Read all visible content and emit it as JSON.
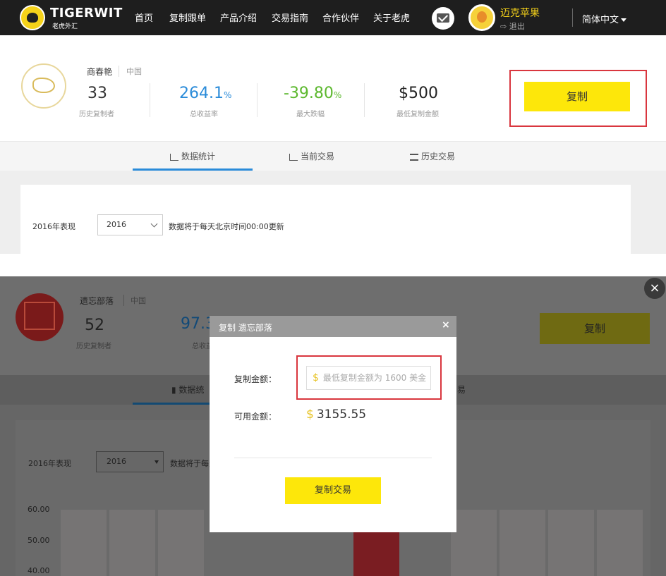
{
  "top": {
    "logo": {
      "brand": "TIGERWIT",
      "sub": "老虎外汇"
    },
    "nav": [
      "首页",
      "复制跟单",
      "产品介绍",
      "交易指南",
      "合作伙伴",
      "关于老虎"
    ],
    "user": {
      "name": "迈克苹果",
      "logout": "退出"
    },
    "language": "简体中文",
    "trader": {
      "name": "商春艳",
      "country": "中国",
      "copiers": {
        "value": "33",
        "label": "历史复制者"
      },
      "return": {
        "value": "264.1",
        "unit": "%",
        "label": "总收益率"
      },
      "drawdown": {
        "value": "-39.80",
        "unit": "%",
        "label": "最大跌幅"
      },
      "min_copy": {
        "value": "$500",
        "label": "最低复制金额"
      },
      "copy_button": "复制"
    },
    "tabs": [
      "数据统计",
      "当前交易",
      "历史交易"
    ],
    "year_label": "2016年表现",
    "year_select": "2016",
    "update_note": "数据将于每天北京时间00:00更新"
  },
  "bottom": {
    "trader": {
      "name": "遗忘部落",
      "country": "中国",
      "copiers": {
        "value": "52",
        "label": "历史复制者"
      },
      "return_partial": "97.3",
      "return_label_partial": "总收益",
      "copy_button": "复制"
    },
    "tab_stats_partial": "数据统",
    "tab_history_partial": "易",
    "year_label": "2016年表现",
    "year_select": "2016",
    "update_note_partial": "数据将于每天",
    "y_ticks": [
      "60.00",
      "50.00",
      "40.00"
    ],
    "close_icon": "×",
    "modal": {
      "title": "复制 遗忘部落",
      "close": "×",
      "amount_label": "复制金额：",
      "amount_placeholder": "最低复制金额为 1600 美金",
      "currency": "$",
      "available_label": "可用金额：",
      "available_value": "3155.55",
      "submit": "复制交易"
    }
  },
  "colors": {
    "accent_yellow": "#fde70a",
    "positive_blue": "#2a8bd9",
    "negative_green": "#5cb82e",
    "highlight_red": "#d9363e"
  }
}
